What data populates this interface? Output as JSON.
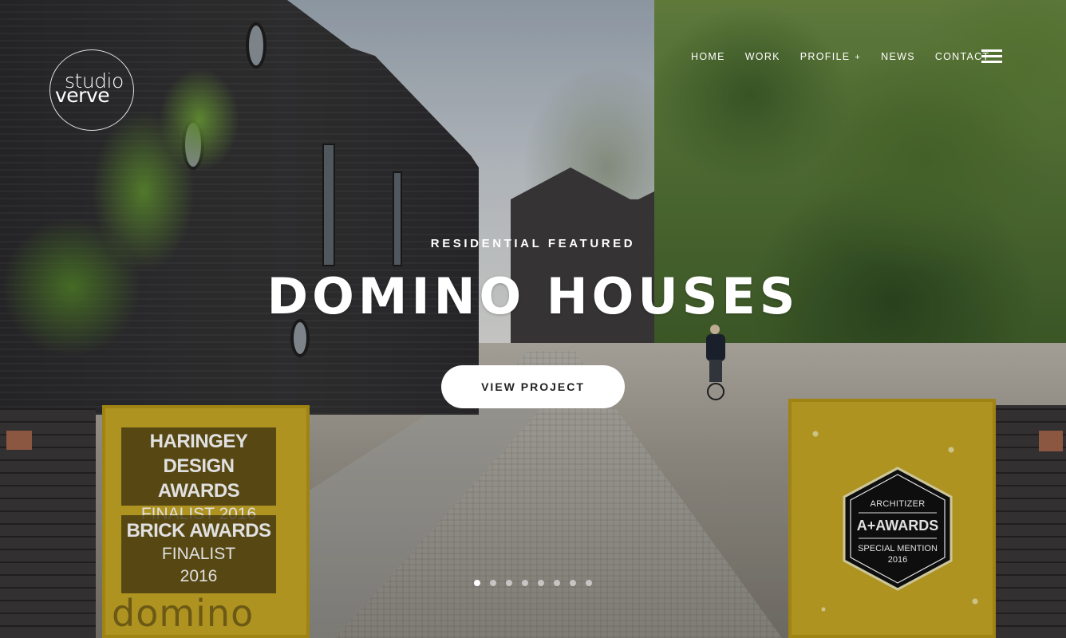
{
  "brand": {
    "logo_line1": "studio",
    "logo_line2": "verve"
  },
  "nav": {
    "items": [
      {
        "label": "HOME"
      },
      {
        "label": "WORK"
      },
      {
        "label": "PROFILE",
        "suffix": "+"
      },
      {
        "label": "NEWS"
      },
      {
        "label": "CONTACT"
      }
    ],
    "menu_icon": "hamburger-icon"
  },
  "hero": {
    "eyebrow": "RESIDENTIAL FEATURED",
    "title": "DOMINO HOUSES",
    "cta_label": "VIEW PROJECT"
  },
  "slider": {
    "total": 8,
    "active_index": 0
  },
  "scene_text": {
    "sign_1_title_a": "HARINGEY DESIGN",
    "sign_1_title_b": "AWARDS",
    "sign_1_sub": "FINALIST 2016",
    "sign_2_title": "BRICK AWARDS",
    "sign_2_sub_a": "FINALIST",
    "sign_2_sub_b": "2016",
    "gate_script": "domino",
    "badge_top": "ARCHITIZER",
    "badge_main": "A+AWARDS",
    "badge_sub": "SPECIAL MENTION",
    "badge_year": "2016"
  },
  "colors": {
    "accent_yellow": "#c7a826",
    "text_white": "#ffffff",
    "brick_dark": "#2f2e30"
  }
}
